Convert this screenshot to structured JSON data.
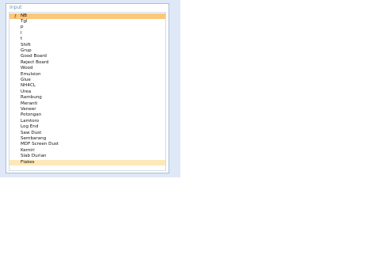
{
  "group": {
    "title": "Input"
  },
  "list": {
    "key_icon": "key-icon",
    "items": [
      {
        "label": "NB",
        "state": "selected",
        "key": true
      },
      {
        "label": "Tgl",
        "state": "normal"
      },
      {
        "label": "p",
        "state": "normal"
      },
      {
        "label": "l",
        "state": "normal"
      },
      {
        "label": "t",
        "state": "normal"
      },
      {
        "label": "Shift",
        "state": "normal"
      },
      {
        "label": "Grup",
        "state": "normal"
      },
      {
        "label": "Good Board",
        "state": "normal"
      },
      {
        "label": "Reject Board",
        "state": "normal"
      },
      {
        "label": "Wood",
        "state": "normal"
      },
      {
        "label": "Emulsion",
        "state": "normal"
      },
      {
        "label": "Glue",
        "state": "normal"
      },
      {
        "label": "NH4CL",
        "state": "normal"
      },
      {
        "label": "Urea",
        "state": "normal"
      },
      {
        "label": "Rambung",
        "state": "normal"
      },
      {
        "label": "Meranti",
        "state": "normal"
      },
      {
        "label": "Veneer",
        "state": "normal"
      },
      {
        "label": "Potongan",
        "state": "normal"
      },
      {
        "label": "Lamtoro",
        "state": "normal"
      },
      {
        "label": "Log End",
        "state": "normal"
      },
      {
        "label": "Saw Dust",
        "state": "normal"
      },
      {
        "label": "Sembarang",
        "state": "normal"
      },
      {
        "label": "MDF Screen Dust",
        "state": "normal"
      },
      {
        "label": "Kemiri",
        "state": "normal"
      },
      {
        "label": "Slab Durian",
        "state": "normal"
      },
      {
        "label": "Flakes",
        "state": "highlighted"
      }
    ]
  },
  "colors": {
    "panel_bg": "#dfe8f6",
    "selected_bg": "#fbc77a",
    "highlight_bg": "#fde8b8",
    "border": "#a9bfd6"
  }
}
